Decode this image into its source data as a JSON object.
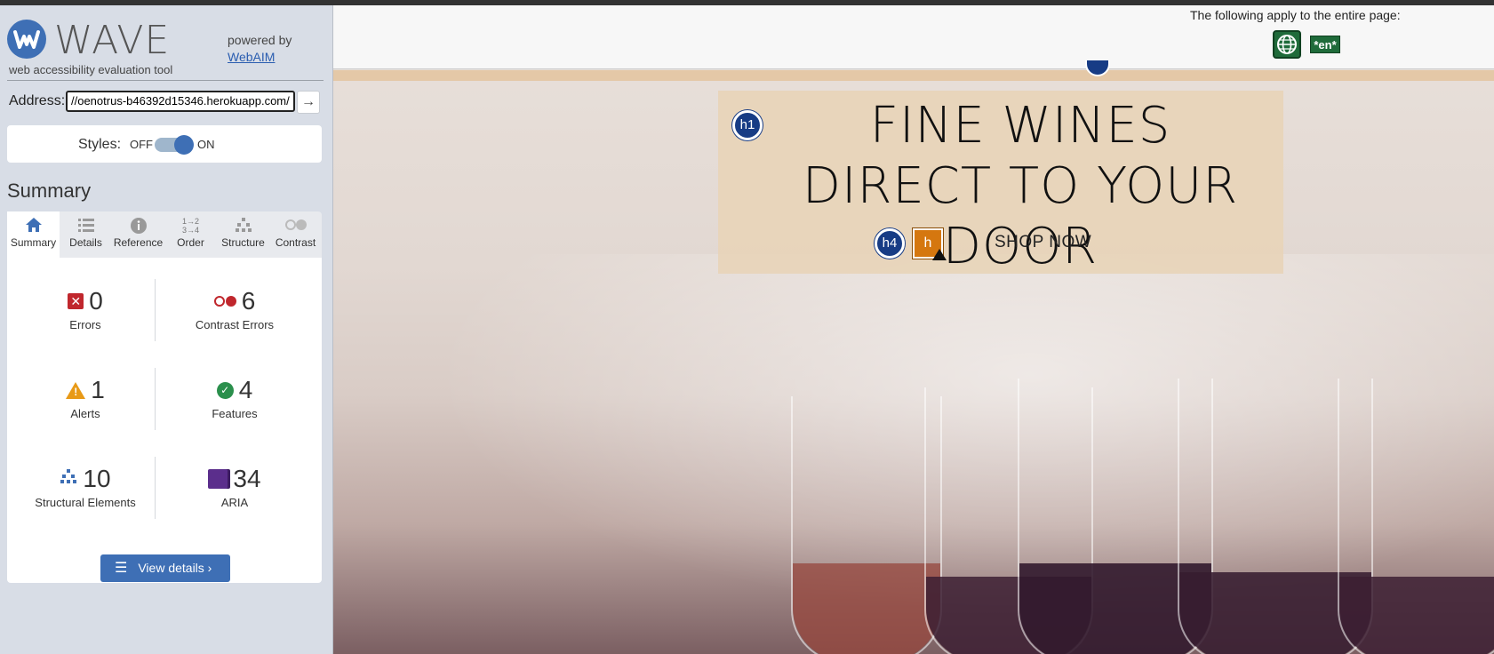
{
  "wave": {
    "brand": "WAVE",
    "subtitle": "web accessibility evaluation tool",
    "powered_by": "powered by",
    "webaim_link": "WebAIM",
    "address_label": "Address:",
    "address_value": "//oenotrus-b46392d15346.herokuapp.com/",
    "go_icon": "arrow-right-icon",
    "styles_label": "Styles:",
    "styles_off": "OFF",
    "styles_on": "ON",
    "styles_state": "ON",
    "summary_heading": "Summary",
    "tabs": [
      {
        "label": "Summary",
        "icon": "home-icon",
        "active": true
      },
      {
        "label": "Details",
        "icon": "list-icon",
        "active": false
      },
      {
        "label": "Reference",
        "icon": "info-icon",
        "active": false
      },
      {
        "label": "Order",
        "icon": "order-icon",
        "active": false
      },
      {
        "label": "Structure",
        "icon": "structure-icon",
        "active": false
      },
      {
        "label": "Contrast",
        "icon": "contrast-icon",
        "active": false
      }
    ],
    "stats": {
      "errors": {
        "value": "0",
        "label": "Errors"
      },
      "contrast_errors": {
        "value": "6",
        "label": "Contrast Errors"
      },
      "alerts": {
        "value": "1",
        "label": "Alerts"
      },
      "features": {
        "value": "4",
        "label": "Features"
      },
      "structural": {
        "value": "10",
        "label": "Structural Elements"
      },
      "aria": {
        "value": "34",
        "label": "ARIA"
      }
    },
    "view_details": "View details ›"
  },
  "page": {
    "apply_text": "The following apply to the entire page:",
    "lang_badge": "*en*",
    "hero_title": "FINE WINES DIRECT TO YOUR DOOR",
    "h1_badge": "h1",
    "h4_badge": "h4",
    "skip_badge": "h",
    "shop_now": "SHOP NOW"
  },
  "colors": {
    "wave_blue": "#3e6fb5",
    "error_red": "#c0272d",
    "alert_orange": "#e89a17",
    "feature_green": "#2a8f4c",
    "aria_purple": "#5b2e8c",
    "hero_bg": "#e8d4b8",
    "badge_navy": "#173c85"
  }
}
